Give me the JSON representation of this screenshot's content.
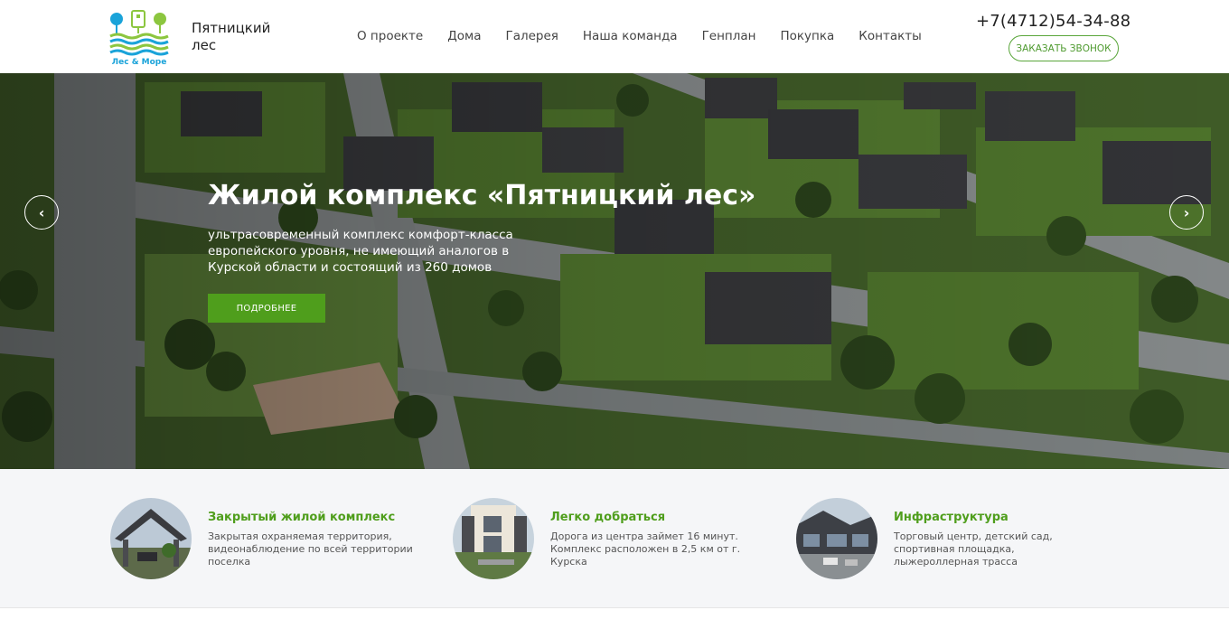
{
  "header": {
    "logo_text": "Лес & Море",
    "site_name": "Пятницкий лес",
    "nav": [
      "О проекте",
      "Дома",
      "Галерея",
      "Наша команда",
      "Генплан",
      "Покупка",
      "Контакты"
    ],
    "phone": "+7(4712)54-34-88",
    "callback_label": "ЗАКАЗАТЬ ЗВОНОК"
  },
  "hero": {
    "title": "Жилой комплекс «Пятницкий лес»",
    "text": "ультрасовременный комплекс комфорт-класса европейского уровня, не имеющий аналогов в Курской области и состоящий из 260 домов",
    "button_label": "ПОДРОБНЕЕ",
    "prev_icon": "chevron-left-icon",
    "next_icon": "chevron-right-icon"
  },
  "features": [
    {
      "title": "Закрытый жилой комплекс",
      "text": "Закрытая охраняемая территория, видеонаблюдение по всей территории поселка"
    },
    {
      "title": "Легко добраться",
      "text": "Дорога из центра займет 16 минут. Комплекс расположен в 2,5 км от г. Курска"
    },
    {
      "title": "Инфраструктура",
      "text": "Торговый центр, детский сад, спортивная площадка, лыжероллерная трасса"
    }
  ],
  "colors": {
    "accent": "#4f9e1c",
    "logo_blue": "#1aa3d9",
    "logo_green": "#8cc63f"
  }
}
